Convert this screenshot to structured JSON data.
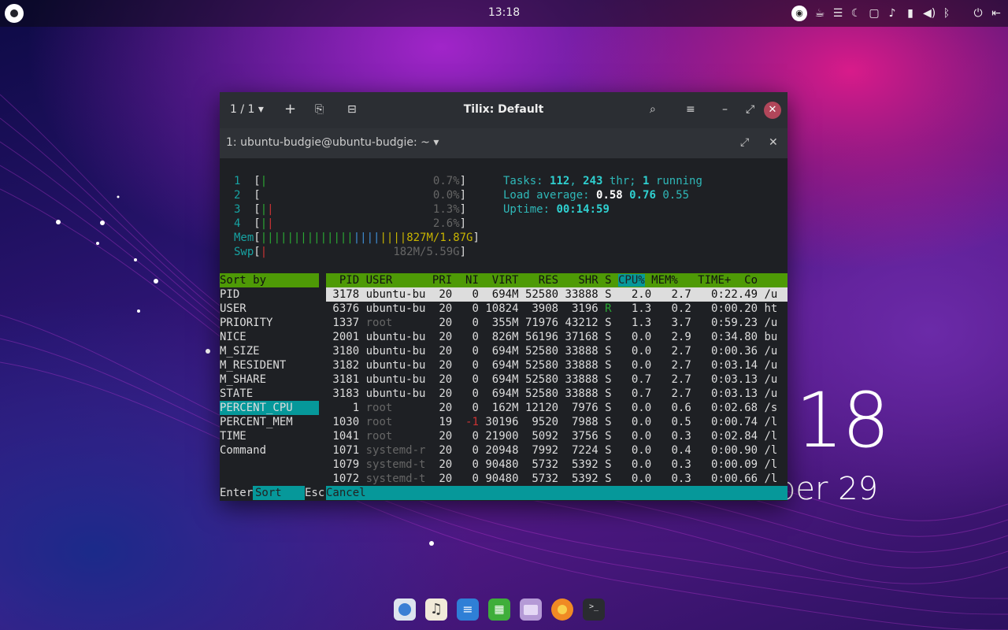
{
  "panel": {
    "clock": "13:18",
    "tray_icons": [
      "app-indicator-icon",
      "caffeine-icon",
      "menu-icon",
      "night-light-icon",
      "folder-icon",
      "notification-icon",
      "battery-icon",
      "volume-icon",
      "bluetooth-icon",
      "power-icon",
      "logout-icon"
    ]
  },
  "desktop_widget": {
    "time": "18",
    "date": "ber 29"
  },
  "window": {
    "title": "Tilix: Default",
    "session": "1 / 1",
    "tab_label": "1: ubuntu-budgie@ubuntu-budgie: ~"
  },
  "htop": {
    "cpus": [
      {
        "n": "1",
        "pct": "0.7%"
      },
      {
        "n": "2",
        "pct": "0.0%"
      },
      {
        "n": "3",
        "pct": "1.3%"
      },
      {
        "n": "4",
        "pct": "2.6%"
      }
    ],
    "mem_label": "Mem",
    "mem_value": "827M/1.87G",
    "swp_label": "Swp",
    "swp_value": "182M/5.59G",
    "tasks_prefix": "Tasks: ",
    "tasks": "112",
    "threads": "243",
    "running": "1",
    "load_label": "Load average: ",
    "load1": "0.58",
    "load5": "0.76",
    "load15": "0.55",
    "uptime_label": "Uptime: ",
    "uptime": "00:14:59",
    "sort_title": "Sort by",
    "sort_options": [
      "PID",
      "USER",
      "PRIORITY",
      "NICE",
      "M_SIZE",
      "M_RESIDENT",
      "M_SHARE",
      "STATE",
      "PERCENT_CPU",
      "PERCENT_MEM",
      "TIME",
      "Command"
    ],
    "sort_selected": "PERCENT_CPU",
    "columns": [
      "PID",
      "USER",
      "PRI",
      "NI",
      "VIRT",
      "RES",
      "SHR",
      "S",
      "CPU%",
      "MEM%",
      "TIME+",
      "Co"
    ],
    "rows": [
      [
        "3178",
        "ubuntu-bu",
        "20",
        "0",
        "694M",
        "52580",
        "33888",
        "S",
        "2.0",
        "2.7",
        "0:22.49",
        "/u"
      ],
      [
        "6376",
        "ubuntu-bu",
        "20",
        "0",
        "10824",
        "3908",
        "3196",
        "R",
        "1.3",
        "0.2",
        "0:00.20",
        "ht"
      ],
      [
        "1337",
        "root",
        "20",
        "0",
        "355M",
        "71976",
        "43212",
        "S",
        "1.3",
        "3.7",
        "0:59.23",
        "/u"
      ],
      [
        "2001",
        "ubuntu-bu",
        "20",
        "0",
        "826M",
        "56196",
        "37168",
        "S",
        "0.0",
        "2.9",
        "0:34.80",
        "bu"
      ],
      [
        "3180",
        "ubuntu-bu",
        "20",
        "0",
        "694M",
        "52580",
        "33888",
        "S",
        "0.0",
        "2.7",
        "0:00.36",
        "/u"
      ],
      [
        "3182",
        "ubuntu-bu",
        "20",
        "0",
        "694M",
        "52580",
        "33888",
        "S",
        "0.0",
        "2.7",
        "0:03.14",
        "/u"
      ],
      [
        "3181",
        "ubuntu-bu",
        "20",
        "0",
        "694M",
        "52580",
        "33888",
        "S",
        "0.7",
        "2.7",
        "0:03.13",
        "/u"
      ],
      [
        "3183",
        "ubuntu-bu",
        "20",
        "0",
        "694M",
        "52580",
        "33888",
        "S",
        "0.7",
        "2.7",
        "0:03.13",
        "/u"
      ],
      [
        "1",
        "root",
        "20",
        "0",
        "162M",
        "12120",
        "7976",
        "S",
        "0.0",
        "0.6",
        "0:02.68",
        "/s"
      ],
      [
        "1030",
        "root",
        "19",
        "-1",
        "30196",
        "9520",
        "7988",
        "S",
        "0.0",
        "0.5",
        "0:00.74",
        "/l"
      ],
      [
        "1041",
        "root",
        "20",
        "0",
        "21900",
        "5092",
        "3756",
        "S",
        "0.0",
        "0.3",
        "0:02.84",
        "/l"
      ],
      [
        "1071",
        "systemd-r",
        "20",
        "0",
        "20948",
        "7992",
        "7224",
        "S",
        "0.0",
        "0.4",
        "0:00.90",
        "/l"
      ],
      [
        "1079",
        "systemd-t",
        "20",
        "0",
        "90480",
        "5732",
        "5392",
        "S",
        "0.0",
        "0.3",
        "0:00.09",
        "/l"
      ],
      [
        "1072",
        "systemd-t",
        "20",
        "0",
        "90480",
        "5732",
        "5392",
        "S",
        "0.0",
        "0.3",
        "0:00.66",
        "/l"
      ]
    ],
    "footer": {
      "enter": "Enter",
      "sort": "Sort  ",
      "esc": "Esc",
      "cancel": "Cancel"
    }
  },
  "dock_apps": [
    "app-grid-icon",
    "music-icon",
    "text-editor-icon",
    "spreadsheet-icon",
    "files-icon",
    "firefox-icon",
    "terminal-icon"
  ]
}
